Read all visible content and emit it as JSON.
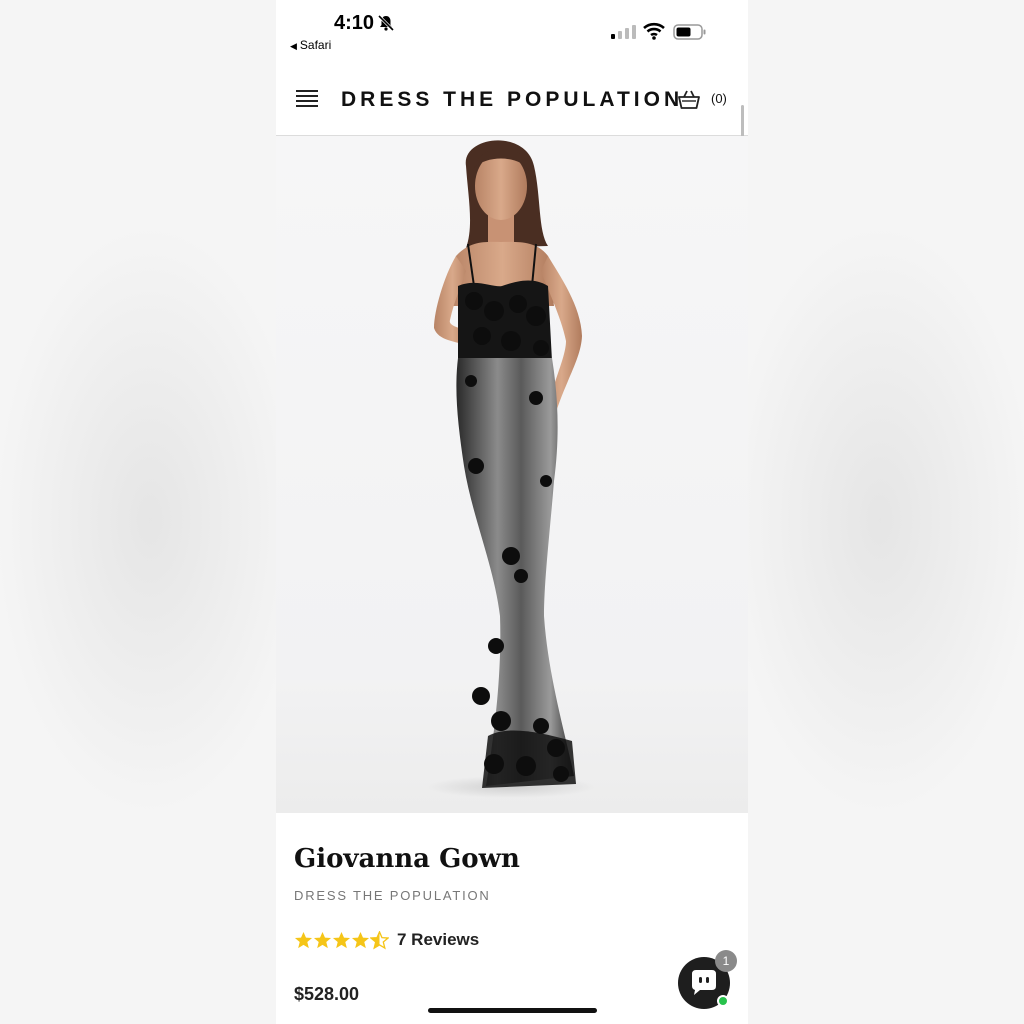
{
  "status_bar": {
    "time": "4:10",
    "back_app": "Safari"
  },
  "header": {
    "brand": "DRESS THE POPULATION",
    "cart_count": "(0)"
  },
  "product": {
    "title": "Giovanna Gown",
    "brand": "DRESS THE POPULATION",
    "rating": 4.5,
    "reviews": "7 Reviews",
    "price": "$528.00"
  },
  "chat": {
    "badge_count": "1"
  },
  "colors": {
    "star": "#f5c518",
    "online": "#27c24c",
    "chat_bg": "#1e1e1e"
  },
  "icons": {
    "menu": "hamburger-icon",
    "cart": "shopping-basket-icon",
    "chat": "chat-bubble-icon",
    "bell": "bell-slash-icon"
  }
}
